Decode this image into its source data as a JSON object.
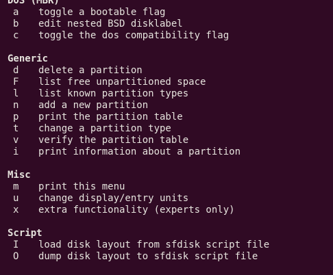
{
  "sections": [
    {
      "title": "DOS (MBR)",
      "items": [
        {
          "key": "a",
          "desc": "toggle a bootable flag"
        },
        {
          "key": "b",
          "desc": "edit nested BSD disklabel"
        },
        {
          "key": "c",
          "desc": "toggle the dos compatibility flag"
        }
      ]
    },
    {
      "title": "Generic",
      "items": [
        {
          "key": "d",
          "desc": "delete a partition"
        },
        {
          "key": "F",
          "desc": "list free unpartitioned space"
        },
        {
          "key": "l",
          "desc": "list known partition types"
        },
        {
          "key": "n",
          "desc": "add a new partition"
        },
        {
          "key": "p",
          "desc": "print the partition table"
        },
        {
          "key": "t",
          "desc": "change a partition type"
        },
        {
          "key": "v",
          "desc": "verify the partition table"
        },
        {
          "key": "i",
          "desc": "print information about a partition"
        }
      ]
    },
    {
      "title": "Misc",
      "items": [
        {
          "key": "m",
          "desc": "print this menu"
        },
        {
          "key": "u",
          "desc": "change display/entry units"
        },
        {
          "key": "x",
          "desc": "extra functionality (experts only)"
        }
      ]
    },
    {
      "title": "Script",
      "items": [
        {
          "key": "I",
          "desc": "load disk layout from sfdisk script file"
        },
        {
          "key": "O",
          "desc": "dump disk layout to sfdisk script file"
        }
      ]
    }
  ],
  "colors": {
    "background": "#300a24",
    "text": "#e6e3dd"
  }
}
